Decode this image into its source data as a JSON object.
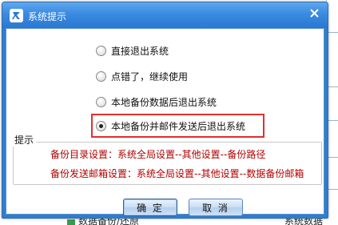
{
  "window": {
    "title": "系统提示"
  },
  "options": [
    {
      "label": "直接退出系统",
      "checked": false
    },
    {
      "label": "点错了，继续使用",
      "checked": false
    },
    {
      "label": "本地备份数据后退出系统",
      "checked": false
    },
    {
      "label": "本地备份并邮件发送后退出系统",
      "checked": true
    }
  ],
  "tips": {
    "legend": "提示",
    "line1": "备份目录设置：系统全局设置--其他设置--备份路径",
    "line2": "备份发送邮箱设置：系统全局设置--其他设置--数据备份邮箱"
  },
  "buttons": {
    "ok": "确 定",
    "cancel": "取 消"
  },
  "background": {
    "bottom_left_text": "数据备份/还原",
    "bottom_right_text": "系统数据"
  },
  "colors": {
    "highlight": "#e03030",
    "tip_text": "#b00000",
    "titlebar": "#3a8ae0"
  }
}
